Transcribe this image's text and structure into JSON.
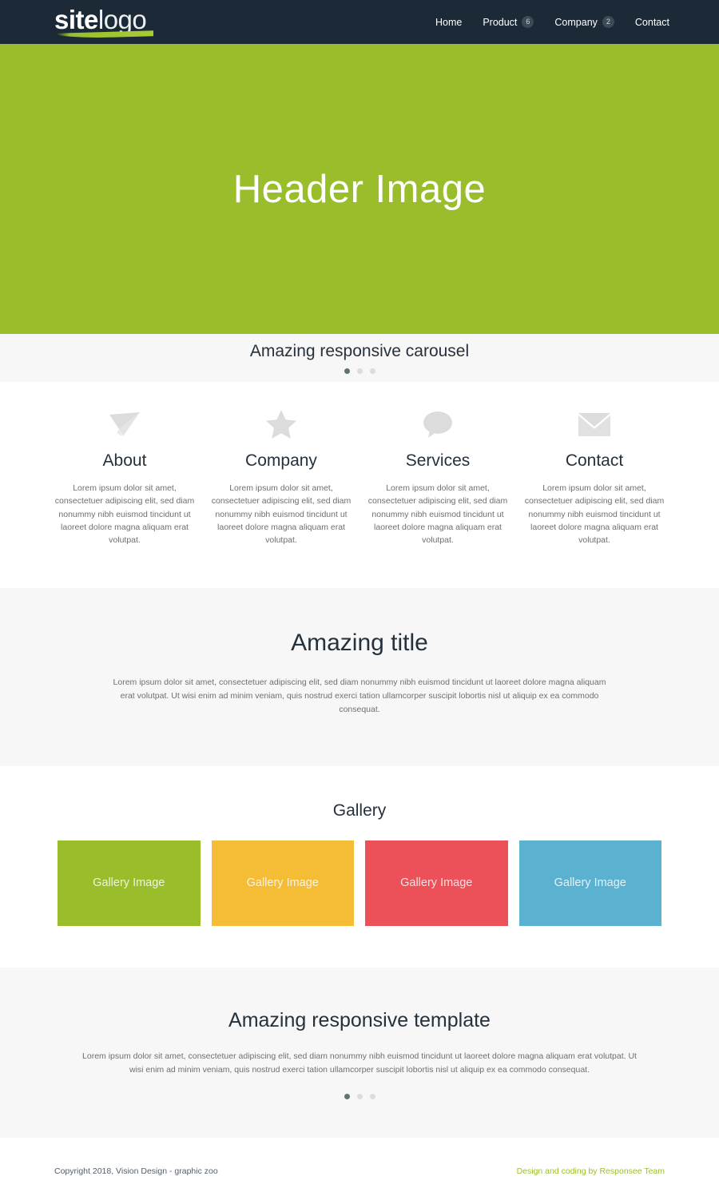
{
  "colors": {
    "nav_bg": "#1b2a36",
    "brand_green": "#9ABE2B",
    "band_gray": "#f7f7f7",
    "heading": "#25313d",
    "body_text": "#6f6f6f"
  },
  "header": {
    "logo_bold": "site",
    "logo_thin": "logo",
    "nav": [
      {
        "label": "Home",
        "badge": null,
        "icon": "nav-link"
      },
      {
        "label": "Product",
        "badge": "6",
        "icon": "nav-link"
      },
      {
        "label": "Company",
        "badge": "2",
        "icon": "nav-link"
      },
      {
        "label": "Contact",
        "badge": null,
        "icon": "nav-link"
      }
    ]
  },
  "hero": {
    "title": "Header Image"
  },
  "carousel": {
    "title": "Amazing responsive carousel",
    "dots": 3,
    "active_dot": 0
  },
  "features": [
    {
      "icon": "paper-plane-icon",
      "title": "About",
      "text": "Lorem ipsum dolor sit amet, consectetuer adipiscing elit, sed diam nonummy nibh euismod tincidunt ut laoreet dolore magna aliquam erat volutpat."
    },
    {
      "icon": "star-icon",
      "title": "Company",
      "text": "Lorem ipsum dolor sit amet, consectetuer adipiscing elit, sed diam nonummy nibh euismod tincidunt ut laoreet dolore magna aliquam erat volutpat."
    },
    {
      "icon": "speech-bubble-icon",
      "title": "Services",
      "text": "Lorem ipsum dolor sit amet, consectetuer adipiscing elit, sed diam nonummy nibh euismod tincidunt ut laoreet dolore magna aliquam erat volutpat."
    },
    {
      "icon": "envelope-icon",
      "title": "Contact",
      "text": "Lorem ipsum dolor sit amet, consectetuer adipiscing elit, sed diam nonummy nibh euismod tincidunt ut laoreet dolore magna aliquam erat volutpat."
    }
  ],
  "amazing": {
    "title": "Amazing title",
    "text": "Lorem ipsum dolor sit amet, consectetuer adipiscing elit, sed diam nonummy nibh euismod tincidunt ut laoreet dolore magna aliquam erat volutpat. Ut wisi enim ad minim veniam, quis nostrud exerci tation ullamcorper suscipit lobortis nisl ut aliquip ex ea commodo consequat."
  },
  "gallery": {
    "title": "Gallery",
    "tiles": [
      {
        "label": "Gallery Image",
        "color": "#9ABE2B"
      },
      {
        "label": "Gallery Image",
        "color": "#F5BC35"
      },
      {
        "label": "Gallery Image",
        "color": "#EC5058"
      },
      {
        "label": "Gallery Image",
        "color": "#5BB2D0"
      }
    ]
  },
  "template_band": {
    "title": "Amazing responsive template",
    "text": "Lorem ipsum dolor sit amet, consectetuer adipiscing elit, sed diam nonummy nibh euismod tincidunt ut laoreet dolore magna aliquam erat volutpat. Ut wisi enim ad minim veniam, quis nostrud exerci tation ullamcorper suscipit lobortis nisl ut aliquip ex ea commodo consequat.",
    "dots": 3,
    "active_dot": 0
  },
  "footer": {
    "copyright": "Copyright 2018, Vision Design - graphic zoo",
    "credit": "Design and coding by Responsee Team"
  }
}
